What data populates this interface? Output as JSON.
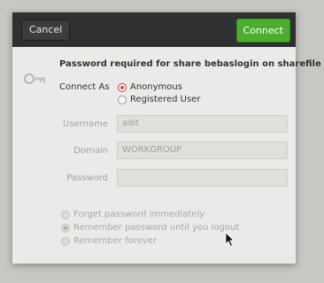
{
  "header": {
    "cancel_label": "Cancel",
    "connect_label": "Connect",
    "accent_color": "#4cae2f"
  },
  "prompt": "Password required for share bebaslogin on sharefile",
  "connect_as": {
    "label": "Connect As",
    "options": [
      {
        "label": "Anonymous",
        "selected": true
      },
      {
        "label": "Registered User",
        "selected": false
      }
    ]
  },
  "fields": {
    "username": {
      "label": "Username",
      "value": "adit"
    },
    "domain": {
      "label": "Domain",
      "value": "WORKGROUP"
    },
    "password": {
      "label": "Password",
      "value": ""
    }
  },
  "remember": {
    "options": [
      {
        "label": "Forget password immediately",
        "selected": false
      },
      {
        "label": "Remember password until you logout",
        "selected": true
      },
      {
        "label": "Remember forever",
        "selected": false
      }
    ]
  },
  "icons": [
    "key-icon",
    "mouse-cursor-icon"
  ]
}
